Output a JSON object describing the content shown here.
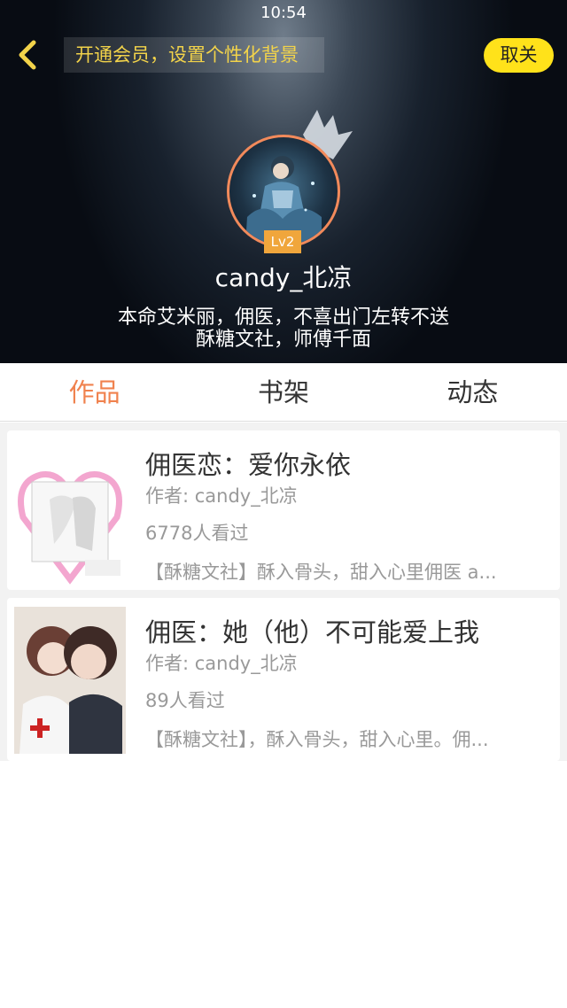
{
  "status_bar": {
    "time": "10:54"
  },
  "header": {
    "vip_banner": "开通会员，设置个性化背景",
    "follow_button": "取关",
    "level": "Lv2",
    "username": "candy_北凉",
    "bio_line1": "本命艾米丽，佣医，不喜出门左转不送",
    "bio_line2": "酥糖文社，师傅千面"
  },
  "tabs": [
    {
      "label": "作品",
      "active": true
    },
    {
      "label": "书架",
      "active": false
    },
    {
      "label": "动态",
      "active": false
    }
  ],
  "works": [
    {
      "title": "佣医恋：爱你永依",
      "author": "作者: candy_北凉",
      "views": "6778人看过",
      "summary": "【酥糖文社】酥入骨头，甜入心里佣医 a..."
    },
    {
      "title": "佣医：她（他）不可能爱上我",
      "author": "作者: candy_北凉",
      "views": "89人看过",
      "summary": "【酥糖文社】，酥入骨头，甜入心里。佣..."
    }
  ],
  "colors": {
    "accent_orange": "#f0824e",
    "follow_yellow": "#ffe21a",
    "vip_text": "#f2d34a"
  }
}
